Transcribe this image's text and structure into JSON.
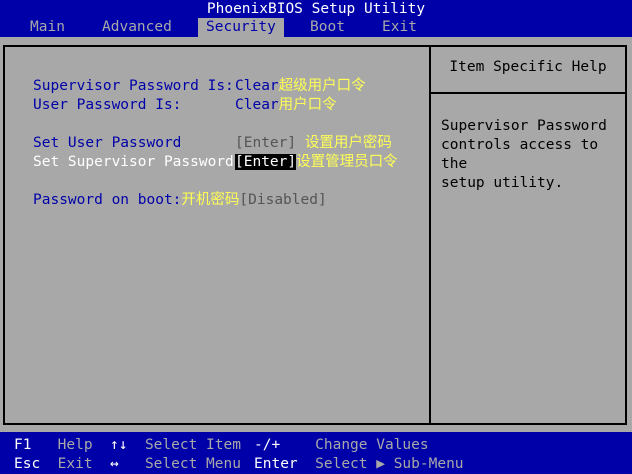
{
  "title": "PhoenixBIOS Setup Utility",
  "menu": [
    {
      "label": "Main"
    },
    {
      "label": "Advanced"
    },
    {
      "label": "Security"
    },
    {
      "label": "Boot"
    },
    {
      "label": "Exit"
    }
  ],
  "settings": {
    "supervisor_status": {
      "label": "Supervisor Password Is:",
      "value": "Clear",
      "note": "超级用户口令"
    },
    "user_status": {
      "label": "User Password Is:",
      "value": "Clear",
      "note": "用户口令"
    },
    "set_user": {
      "label": "Set User Password",
      "value": "[Enter]",
      "note": "设置用户密码"
    },
    "set_supervisor": {
      "label": "Set Supervisor Password",
      "value": "[Enter]",
      "note": "设置管理员口令"
    },
    "password_on_boot": {
      "label": "Password on boot:",
      "note": "开机密码",
      "value": "[Disabled]"
    }
  },
  "help": {
    "title": "Item Specific Help",
    "text": "Supervisor Password\ncontrols access to the\nsetup utility."
  },
  "keys": {
    "f1": {
      "key": "F1",
      "desc": "Help"
    },
    "esc": {
      "key": "Esc",
      "desc": "Exit"
    },
    "updown": {
      "key": "↑↓",
      "desc": "Select Item"
    },
    "leftright": {
      "key": "↔",
      "desc": "Select Menu"
    },
    "minusplus": {
      "key": "-/+",
      "desc": "Change Values"
    },
    "enter": {
      "key": "Enter",
      "desc": "Select ▶ Sub-Menu"
    }
  }
}
